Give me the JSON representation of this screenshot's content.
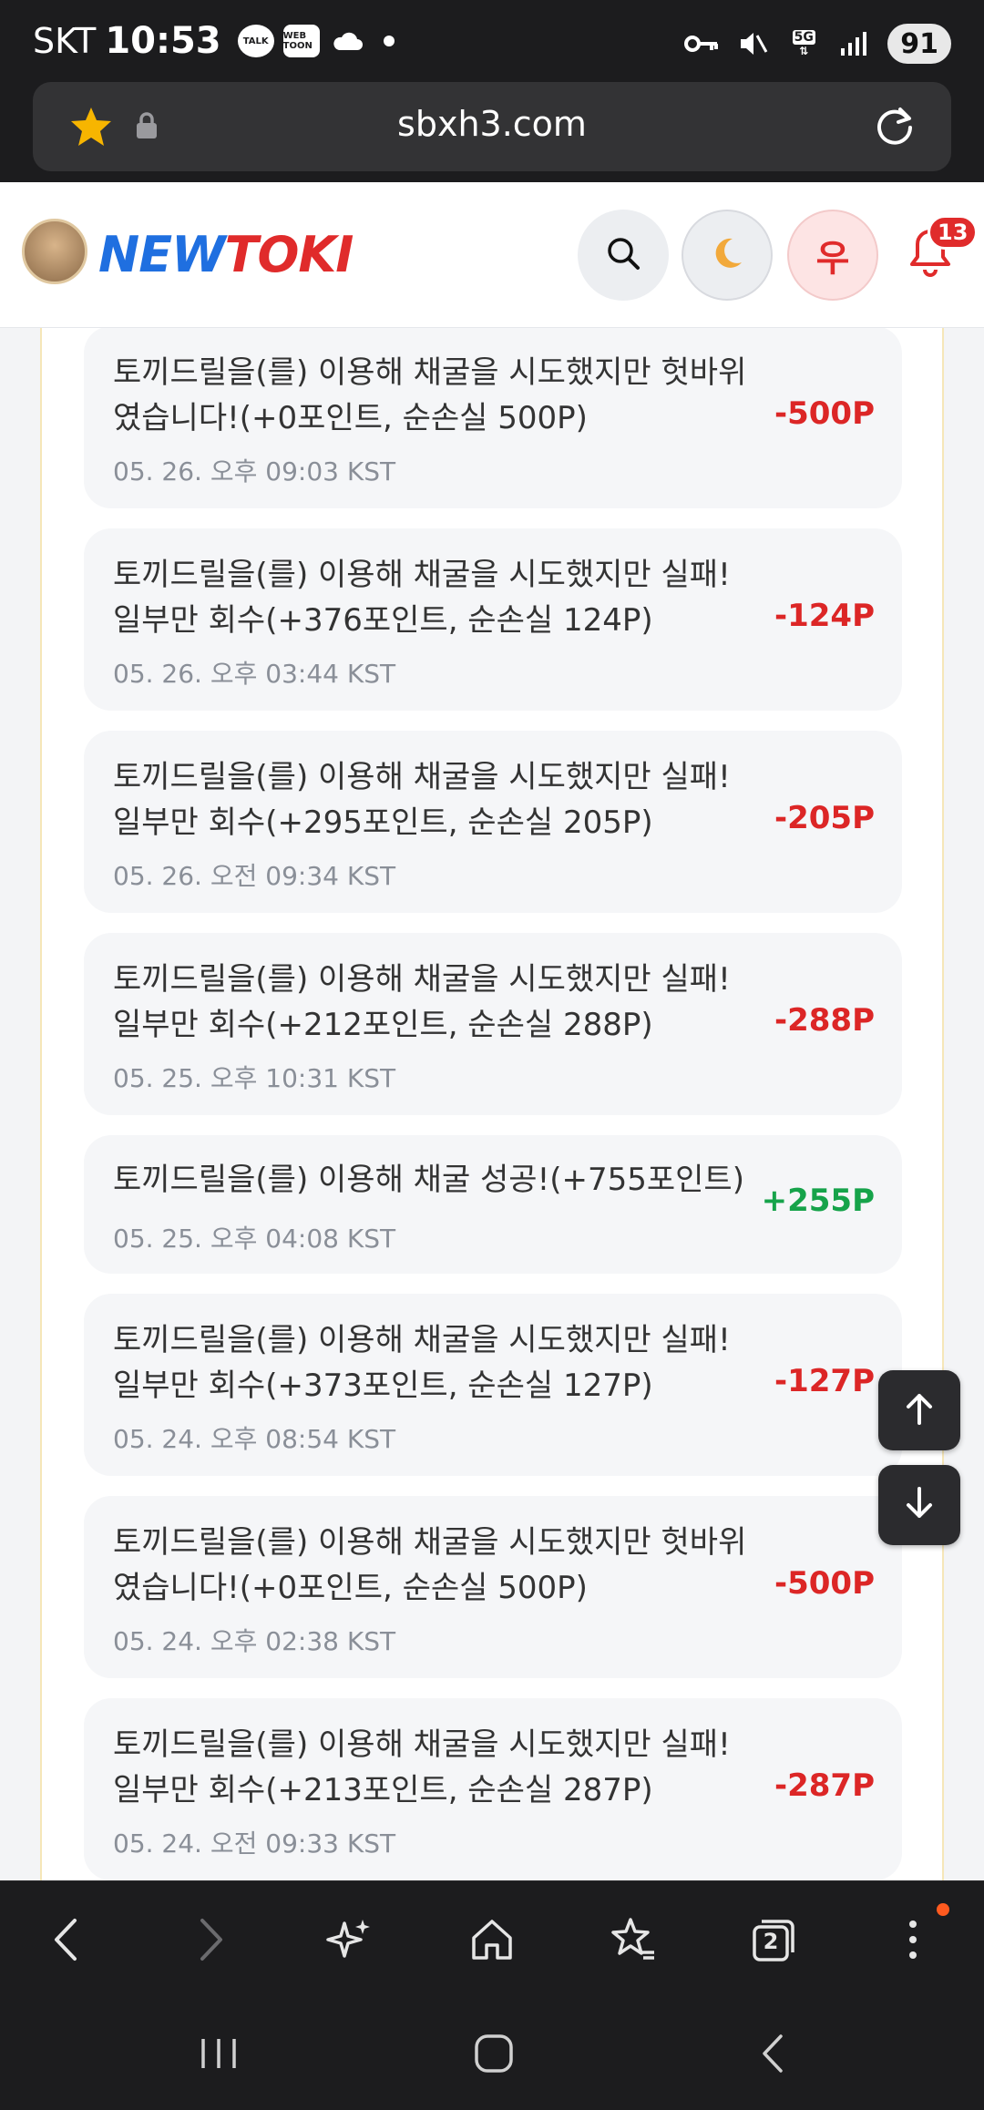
{
  "status_bar": {
    "carrier": "SKT",
    "time": "10:53",
    "notif_talk": "TALK",
    "notif_webtoon": "WEB TOON",
    "network": "5G",
    "battery": "91"
  },
  "browser": {
    "url": "sbxh3.com"
  },
  "header": {
    "logo_new": "NEW",
    "logo_toki": "TOKI",
    "user_initial": "우",
    "notification_count": "13"
  },
  "history": [
    {
      "text": "토끼드릴을(를) 이용해 채굴을 시도했지만 헛바위였습니다!(+0포인트, 순손실 500P)",
      "time": "05. 26. 오후 09:03 KST",
      "amount": "-500P",
      "positive": false
    },
    {
      "text": "토끼드릴을(를) 이용해 채굴을 시도했지만 실패! 일부만 회수(+376포인트, 순손실 124P)",
      "time": "05. 26. 오후 03:44 KST",
      "amount": "-124P",
      "positive": false
    },
    {
      "text": "토끼드릴을(를) 이용해 채굴을 시도했지만 실패! 일부만 회수(+295포인트, 순손실 205P)",
      "time": "05. 26. 오전 09:34 KST",
      "amount": "-205P",
      "positive": false
    },
    {
      "text": "토끼드릴을(를) 이용해 채굴을 시도했지만 실패! 일부만 회수(+212포인트, 순손실 288P)",
      "time": "05. 25. 오후 10:31 KST",
      "amount": "-288P",
      "positive": false
    },
    {
      "text": "토끼드릴을(를) 이용해 채굴 성공!(+755포인트)",
      "time": "05. 25. 오후 04:08 KST",
      "amount": "+255P",
      "positive": true
    },
    {
      "text": "토끼드릴을(를) 이용해 채굴을 시도했지만 실패! 일부만 회수(+373포인트, 순손실 127P)",
      "time": "05. 24. 오후 08:54 KST",
      "amount": "-127P",
      "positive": false
    },
    {
      "text": "토끼드릴을(를) 이용해 채굴을 시도했지만 헛바위였습니다!(+0포인트, 순손실 500P)",
      "time": "05. 24. 오후 02:38 KST",
      "amount": "-500P",
      "positive": false
    },
    {
      "text": "토끼드릴을(를) 이용해 채굴을 시도했지만 실패! 일부만 회수(+213포인트, 순손실 287P)",
      "time": "05. 24. 오전 09:33 KST",
      "amount": "-287P",
      "positive": false
    }
  ],
  "toolbar": {
    "tabs_count": "2"
  },
  "colors": {
    "negative": "#dc2626",
    "positive": "#16a34a",
    "brand_blue": "#1f6fe0",
    "brand_red": "#e02b2b"
  }
}
